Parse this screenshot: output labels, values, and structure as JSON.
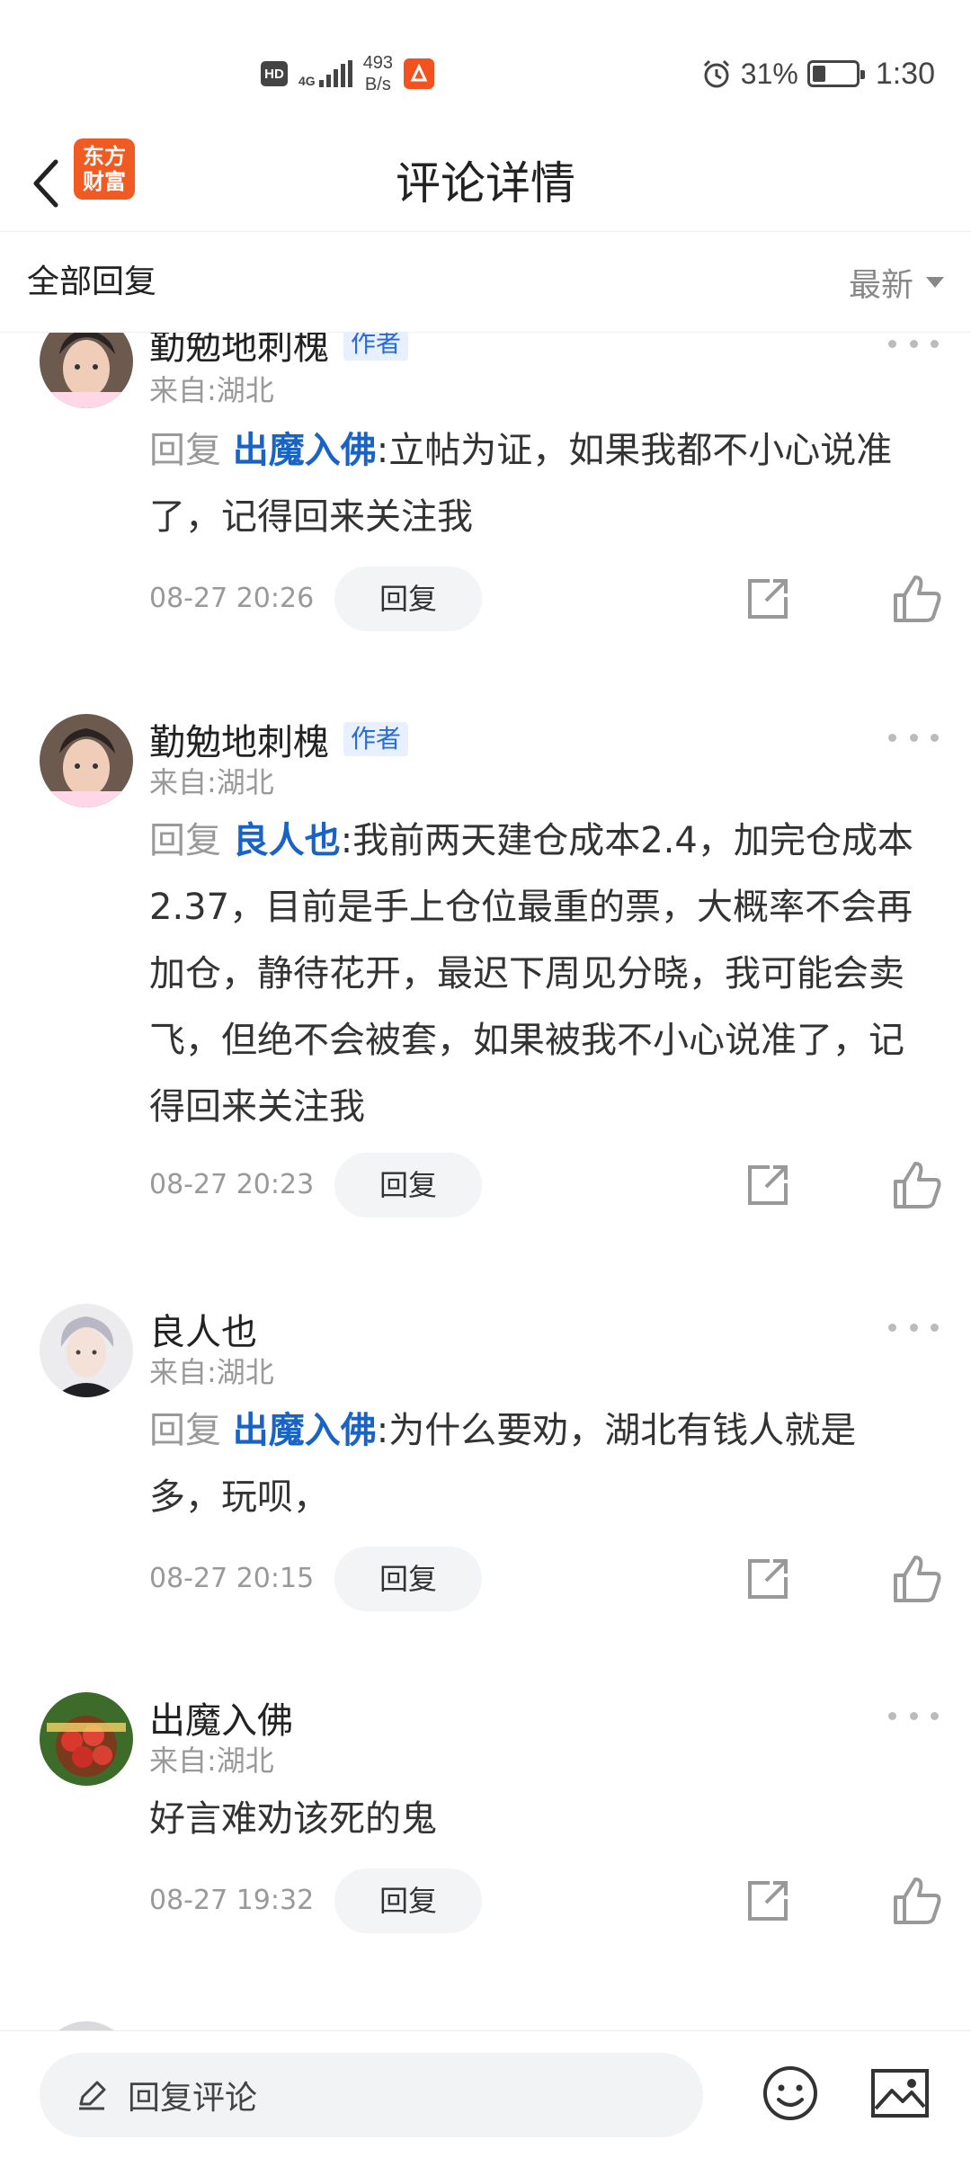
{
  "status_bar": {
    "hd": "HD",
    "network": "4G",
    "speed_value": "493",
    "speed_unit": "B/s",
    "battery_percent": "31%",
    "battery_level": 0.31,
    "time": "1:30"
  },
  "nav": {
    "logo_line1": "东方",
    "logo_line2": "财富",
    "title": "评论详情"
  },
  "sort_bar": {
    "title": "全部回复",
    "sort_label": "最新"
  },
  "comments": [
    {
      "username": "勤勉地刺槐",
      "badge": "作者",
      "from": "来自:湖北",
      "reply_prefix": "回复",
      "reply_target": "出魔入佛",
      "colon": ":",
      "text": "立帖为证，如果我都不小心说准了，记得回来关注我",
      "date": "08-27 20:26",
      "reply_label": "回复"
    },
    {
      "username": "勤勉地刺槐",
      "badge": "作者",
      "from": "来自:湖北",
      "reply_prefix": "回复",
      "reply_target": "良人也",
      "colon": ":",
      "text": "我前两天建仓成本2.4，加完仓成本2.37，目前是手上仓位最重的票，大概率不会再加仓，静待花开，最迟下周见分晓，我可能会卖飞，但绝不会被套，如果被我不小心说准了，记得回来关注我",
      "date": "08-27 20:23",
      "reply_label": "回复"
    },
    {
      "username": "良人也",
      "from": "来自:湖北",
      "reply_prefix": "回复",
      "reply_target": "出魔入佛",
      "colon": ":",
      "text": "为什么要劝，湖北有钱人就是多，玩呗，",
      "date": "08-27 20:15",
      "reply_label": "回复"
    },
    {
      "username": "出魔入佛",
      "from": "来自:湖北",
      "text": "好言难劝该死的鬼",
      "date": "08-27 19:32",
      "reply_label": "回复"
    }
  ],
  "input_bar": {
    "placeholder": "回复评论"
  },
  "colors": {
    "brand": "#f15a22",
    "link": "#1a63c6",
    "muted": "#999999"
  }
}
